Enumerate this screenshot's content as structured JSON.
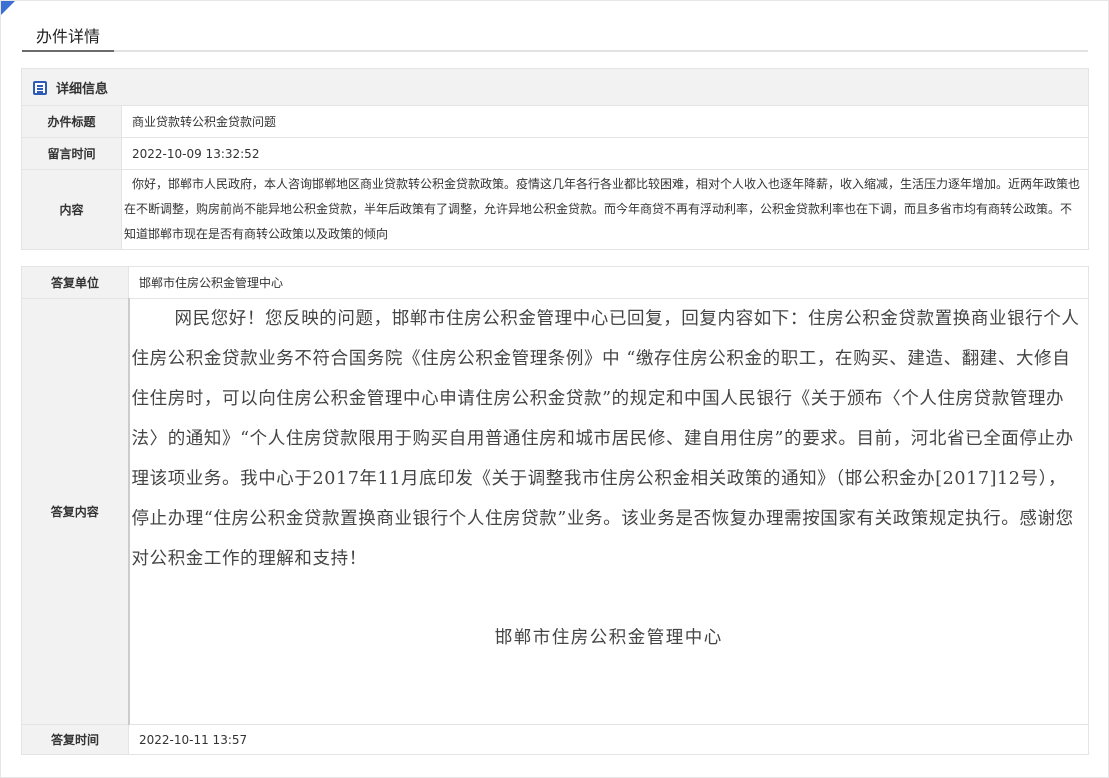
{
  "page": {
    "title": "办件详情"
  },
  "details": {
    "section_title": "详细信息",
    "subject_label": "办件标题",
    "subject_value": "商业贷款转公积金贷款问题",
    "time_label": "留言时间",
    "time_value": "2022-10-09 13:32:52",
    "content_label": "内容",
    "content_value": "你好，邯郸市人民政府，本人咨询邯郸地区商业贷款转公积金贷款政策。疫情这几年各行各业都比较困难，相对个人收入也逐年降薪，收入缩减，生活压力逐年增加。近两年政策也在不断调整，购房前尚不能异地公积金贷款，半年后政策有了调整，允许异地公积金贷款。而今年商贷不再有浮动利率，公积金贷款利率也在下调，而且多省市均有商转公政策。不知道邯郸市现在是否有商转公政策以及政策的倾向"
  },
  "reply": {
    "unit_label": "答复单位",
    "unit_value": "邯郸市住房公积金管理中心",
    "content_label": "答复内容",
    "content_value": "网民您好！您反映的问题，邯郸市住房公积金管理中心已回复，回复内容如下：住房公积金贷款置换商业银行个人住房公积金贷款业务不符合国务院《住房公积金管理条例》中 “缴存住房公积金的职工，在购买、建造、翻建、大修自住住房时，可以向住房公积金管理中心申请住房公积金贷款”的规定和中国人民银行《关于颁布〈个人住房贷款管理办法〉的通知》“个人住房贷款限用于购买自用普通住房和城市居民修、建自用住房”的要求。目前，河北省已全面停止办理该项业务。我中心于2017年11月底印发《关于调整我市住房公积金相关政策的通知》（邯公积金办[2017]12号），停止办理“住房公积金贷款置换商业银行个人住房贷款”业务。该业务是否恢复办理需按国家有关政策规定执行。感谢您对公积金工作的理解和支持！",
    "signature": "邯郸市住房公积金管理中心",
    "time_label": "答复时间",
    "time_value": "2022-10-11 13:57"
  }
}
